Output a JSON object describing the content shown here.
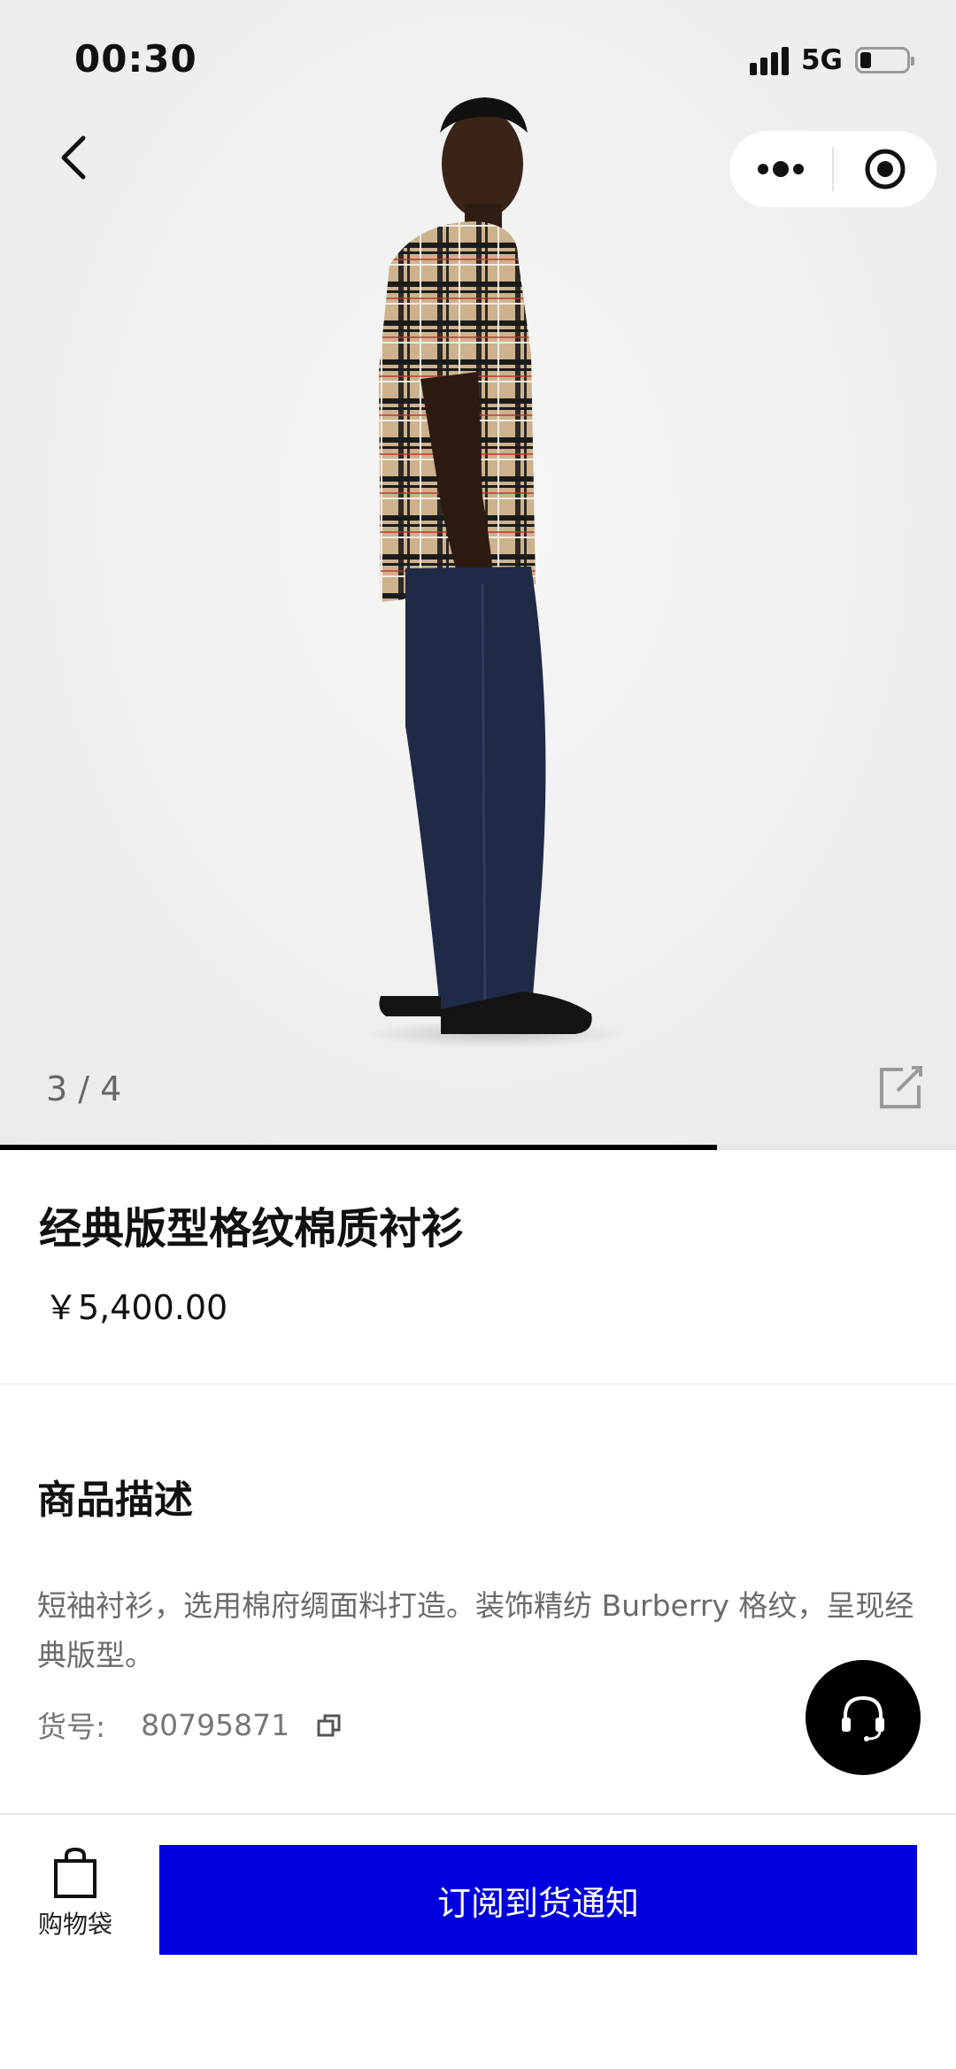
{
  "status_bar": {
    "time": "00:30",
    "network": "5G"
  },
  "gallery": {
    "counter": "3 / 4",
    "current": 3,
    "total": 4,
    "progress_fraction": 0.75
  },
  "product": {
    "title": "经典版型格纹棉质衬衫",
    "price": "￥5,400.00"
  },
  "description": {
    "heading": "商品描述",
    "text": "短袖衬衫，选用棉府绸面料打造。装饰精纺 Burberry 格纹，呈现经典版型。",
    "sku_label": "货号:",
    "sku_value": "80795871"
  },
  "bottom_bar": {
    "cart_label": "购物袋",
    "subscribe_label": "订阅到货通知"
  },
  "icons": {
    "back": "chevron-left-icon",
    "more": "more-dots-icon",
    "close_app": "target-circle-icon",
    "share": "share-external-icon",
    "copy": "copy-icon",
    "service": "headset-icon",
    "cart": "shopping-bag-icon"
  },
  "colors": {
    "accent": "#0000dd",
    "service_button": "#000000",
    "progress": "#000000"
  }
}
